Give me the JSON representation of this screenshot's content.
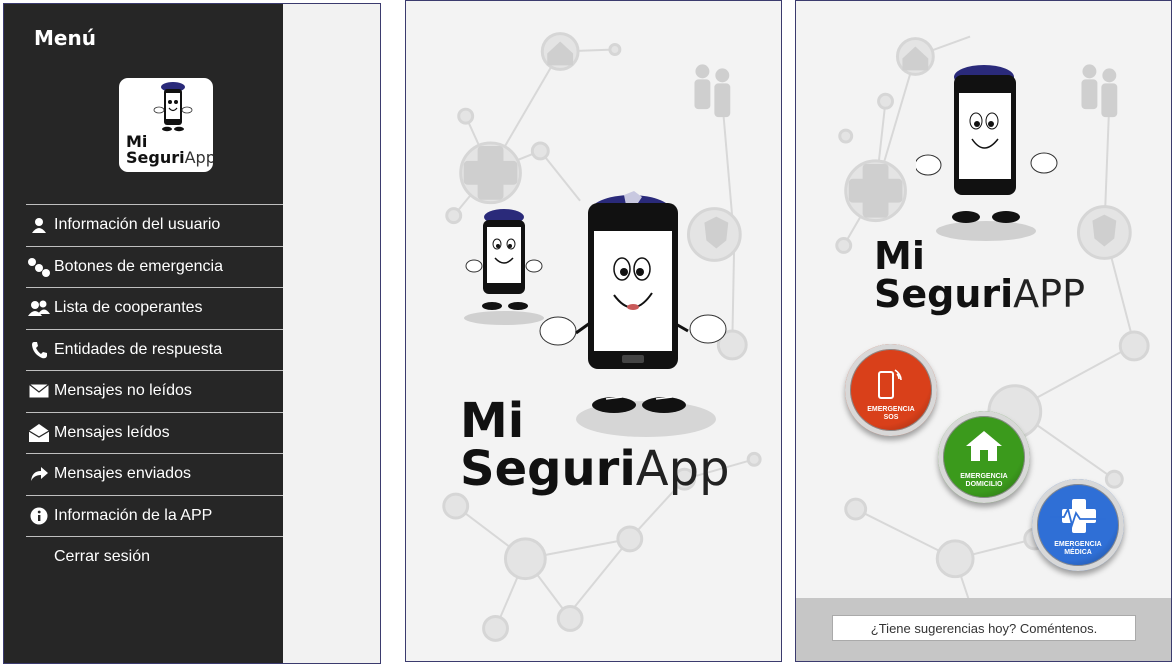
{
  "menu": {
    "title": "Menú",
    "logo": {
      "line1": "Mi",
      "line2_bold": "Seguri",
      "line2_thin": "App"
    },
    "items": [
      {
        "label": "Información del usuario",
        "icon": "user-icon"
      },
      {
        "label": "Botones de emergencia",
        "icon": "buttons-icon"
      },
      {
        "label": "Lista de cooperantes",
        "icon": "group-icon"
      },
      {
        "label": "Entidades de respuesta",
        "icon": "phone-icon"
      },
      {
        "label": "Mensajes no leídos",
        "icon": "envelope-closed-icon"
      },
      {
        "label": "Mensajes leídos",
        "icon": "envelope-open-icon"
      },
      {
        "label": "Mensajes enviados",
        "icon": "share-arrow-icon"
      },
      {
        "label": "Información de la APP",
        "icon": "info-icon"
      },
      {
        "label": "Cerrar sesión",
        "icon": ""
      }
    ]
  },
  "splash": {
    "brand_line1": "Mi",
    "brand_bold": "Seguri",
    "brand_thin": "App"
  },
  "home": {
    "brand_line1": "Mi",
    "brand_bold": "Seguri",
    "brand_thin": "APP",
    "buttons": [
      {
        "label_line1": "EMERGENCIA",
        "label_line2": "SOS",
        "color": "#d9401a"
      },
      {
        "label_line1": "EMERGENCIA",
        "label_line2": "DOMICILIO",
        "color": "#3b9a1c"
      },
      {
        "label_line1": "EMERGENCIA",
        "label_line2": "MÉDICA",
        "color": "#2f6fd6"
      }
    ],
    "suggestion_placeholder": "¿Tiene sugerencias hoy? Coméntenos."
  },
  "colors": {
    "drawer_bg": "#262626",
    "panel_bg": "#f3f3f3",
    "cap_blue": "#2a2a7a"
  }
}
